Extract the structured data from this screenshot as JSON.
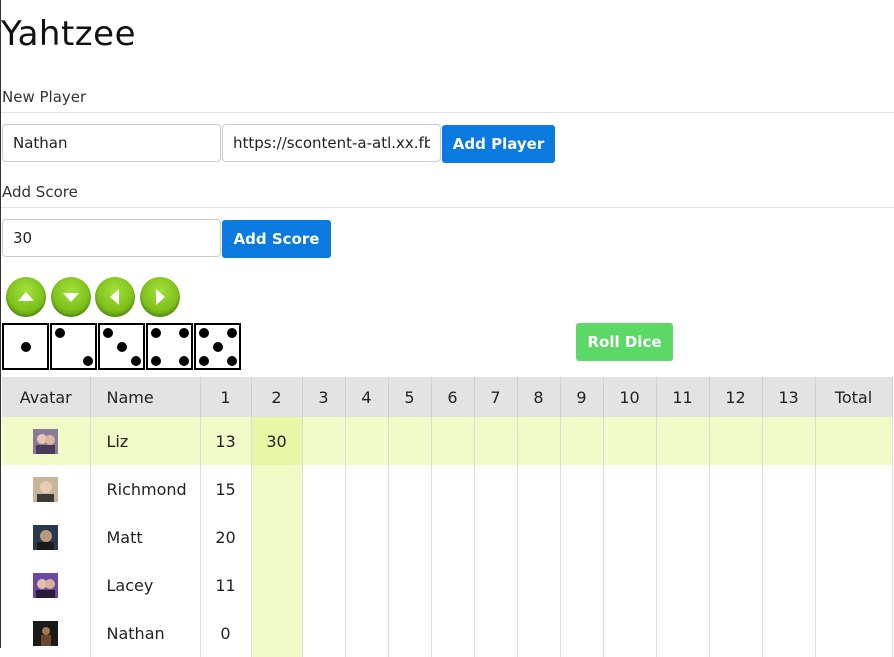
{
  "app": {
    "title": "Yahtzee"
  },
  "new_player": {
    "label": "New Player",
    "name_value": "Nathan",
    "url_value": "https://scontent-a-atl.xx.fb",
    "button_label": "Add Player"
  },
  "add_score": {
    "label": "Add Score",
    "score_value": "30",
    "button_label": "Add Score"
  },
  "arrows": [
    "arrow-up-icon",
    "arrow-down-icon",
    "arrow-left-icon",
    "arrow-right-icon"
  ],
  "dice": [
    1,
    2,
    3,
    4,
    5
  ],
  "roll_button": "Roll Dice",
  "colors": {
    "primary": "#0a7ae0",
    "roll": "#5cd867",
    "arrow_green": "#7fc31c",
    "highlight": "#f1fbc8",
    "highlight_cell": "#e8f7a6",
    "header_bg": "#e3e3e3"
  },
  "table": {
    "headers": [
      "Avatar",
      "Name",
      "1",
      "2",
      "3",
      "4",
      "5",
      "6",
      "7",
      "8",
      "9",
      "10",
      "11",
      "12",
      "13",
      "Total"
    ],
    "rows": [
      {
        "name": "Liz",
        "scores": [
          "13",
          "30",
          "",
          "",
          "",
          "",
          "",
          "",
          "",
          "",
          "",
          "",
          ""
        ],
        "total": ""
      },
      {
        "name": "Richmond",
        "scores": [
          "15",
          "",
          "",
          "",
          "",
          "",
          "",
          "",
          "",
          "",
          "",
          "",
          ""
        ],
        "total": ""
      },
      {
        "name": "Matt",
        "scores": [
          "20",
          "",
          "",
          "",
          "",
          "",
          "",
          "",
          "",
          "",
          "",
          "",
          ""
        ],
        "total": ""
      },
      {
        "name": "Lacey",
        "scores": [
          "11",
          "",
          "",
          "",
          "",
          "",
          "",
          "",
          "",
          "",
          "",
          "",
          ""
        ],
        "total": ""
      },
      {
        "name": "Nathan",
        "scores": [
          "0",
          "",
          "",
          "",
          "",
          "",
          "",
          "",
          "",
          "",
          "",
          "",
          ""
        ],
        "total": ""
      }
    ]
  }
}
